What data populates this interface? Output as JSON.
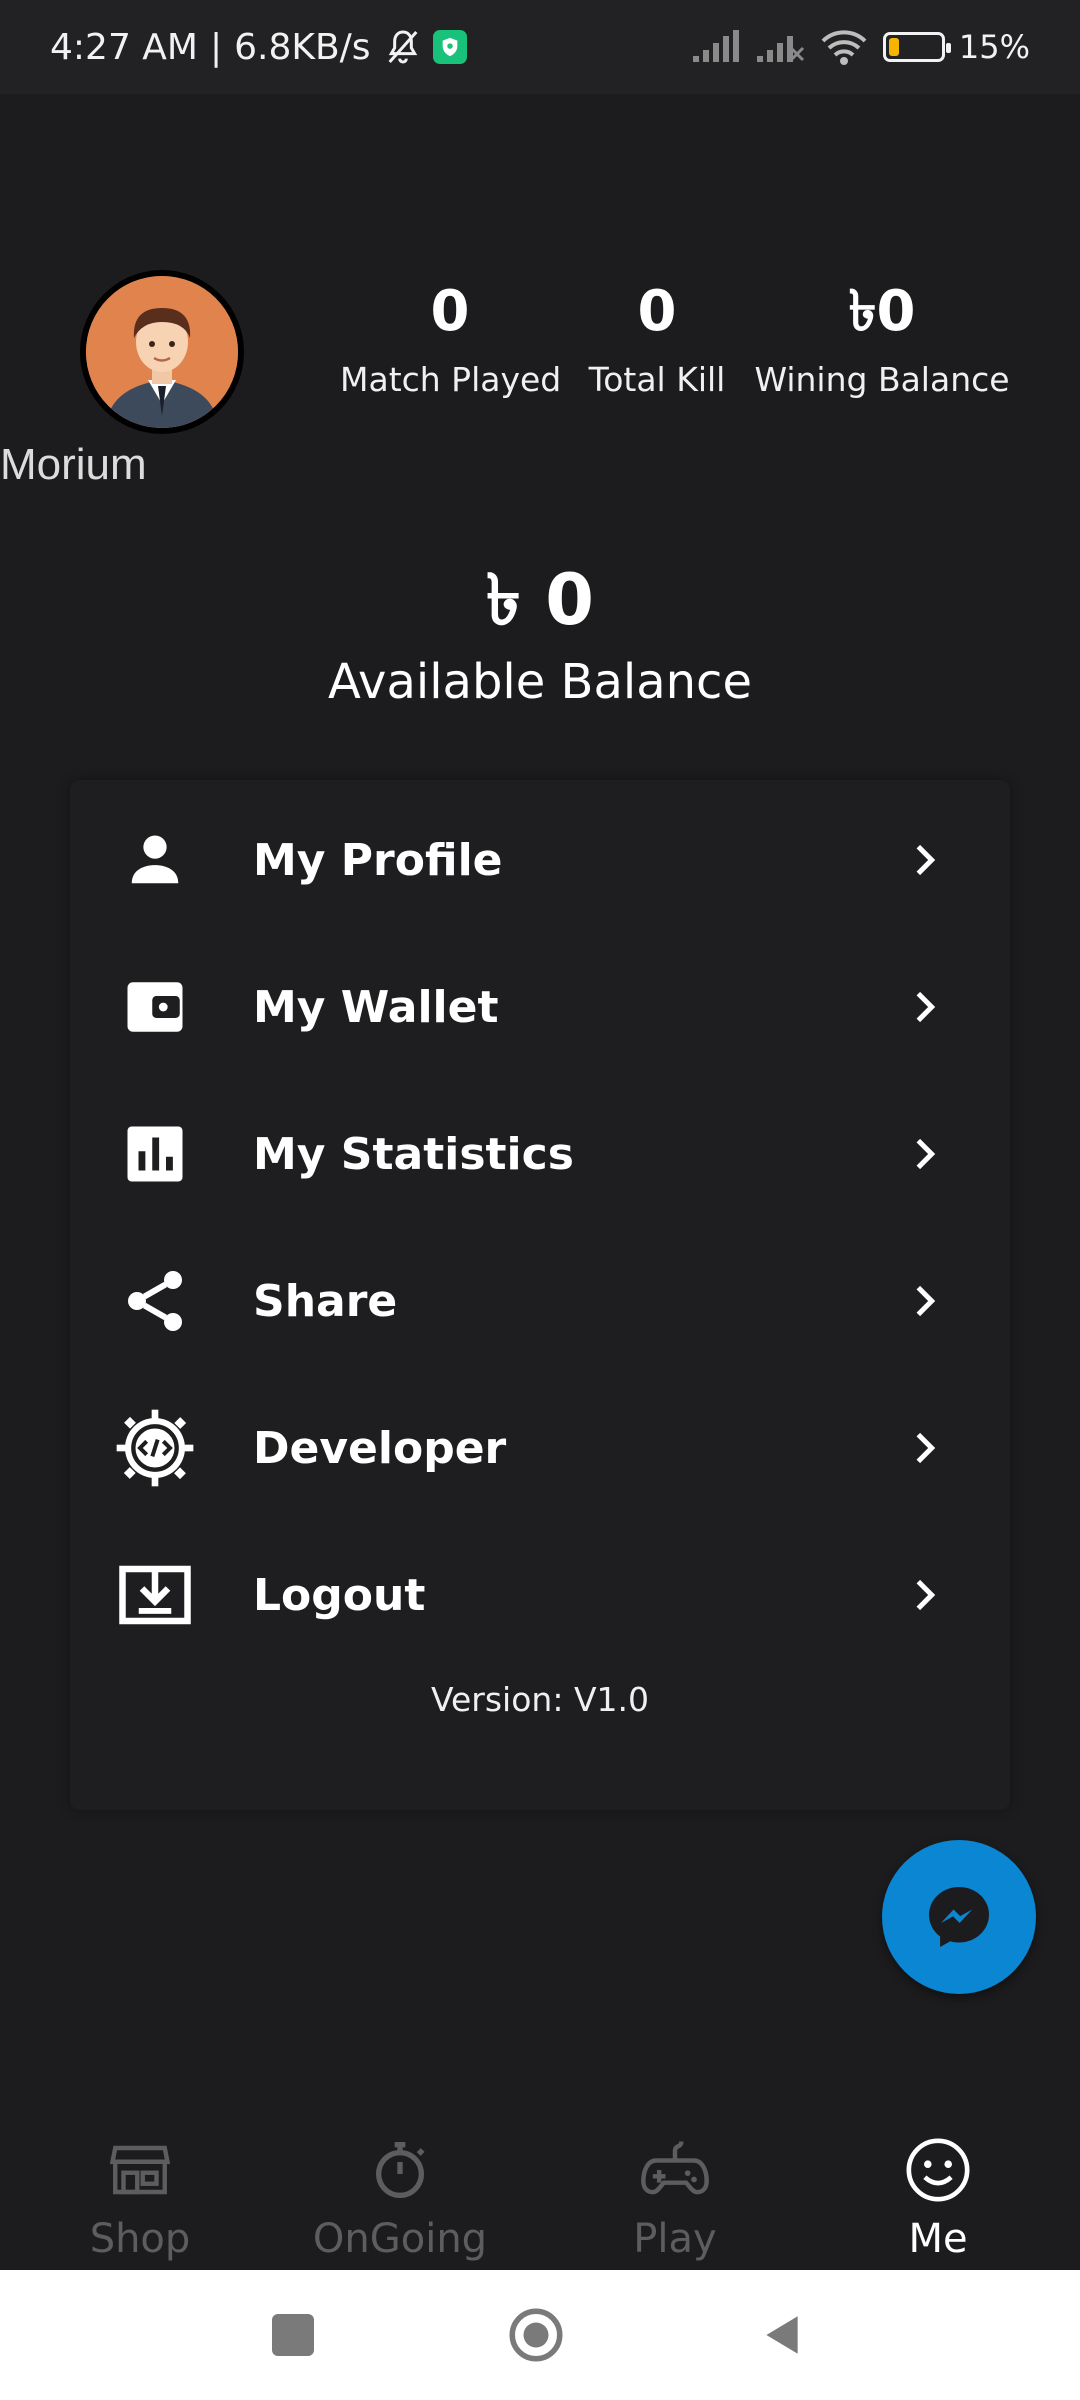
{
  "status_bar": {
    "time": "4:27 AM",
    "separator": "|",
    "speed": "6.8KB/s",
    "battery_percent": "15%",
    "battery_level": 0.15,
    "icons": [
      "bell-off-icon",
      "vpn-shield-icon",
      "signal-icon",
      "signal-x-icon",
      "wifi-icon",
      "battery-icon"
    ]
  },
  "profile": {
    "username": "Morium",
    "avatar_icon": "avatar-icon"
  },
  "stats": [
    {
      "value": "0",
      "label": "Match Played"
    },
    {
      "value": "0",
      "label": "Total Kill"
    },
    {
      "value": "৳0",
      "label": "Wining Balance"
    }
  ],
  "balance": {
    "amount": "৳ 0",
    "label": "Available Balance"
  },
  "menu": {
    "items": [
      {
        "label": "My Profile",
        "icon": "person-icon"
      },
      {
        "label": "My Wallet",
        "icon": "wallet-icon"
      },
      {
        "label": "My Statistics",
        "icon": "statistics-icon"
      },
      {
        "label": "Share",
        "icon": "share-icon"
      },
      {
        "label": "Developer",
        "icon": "developer-gear-icon"
      },
      {
        "label": "Logout",
        "icon": "logout-icon"
      }
    ],
    "version": "Version: V1.0"
  },
  "fab": {
    "icon": "messenger-icon",
    "color": "#0a86d2"
  },
  "bottom_nav": {
    "items": [
      {
        "label": "Shop",
        "icon": "shop-icon",
        "active": false
      },
      {
        "label": "OnGoing",
        "icon": "stopwatch-icon",
        "active": false
      },
      {
        "label": "Play",
        "icon": "gamepad-icon",
        "active": false
      },
      {
        "label": "Me",
        "icon": "smiley-icon",
        "active": true
      }
    ]
  },
  "colors": {
    "background": "#1c1c1e",
    "card": "#1e1e20",
    "inactive": "#5d5d60",
    "active": "#ffffff"
  }
}
